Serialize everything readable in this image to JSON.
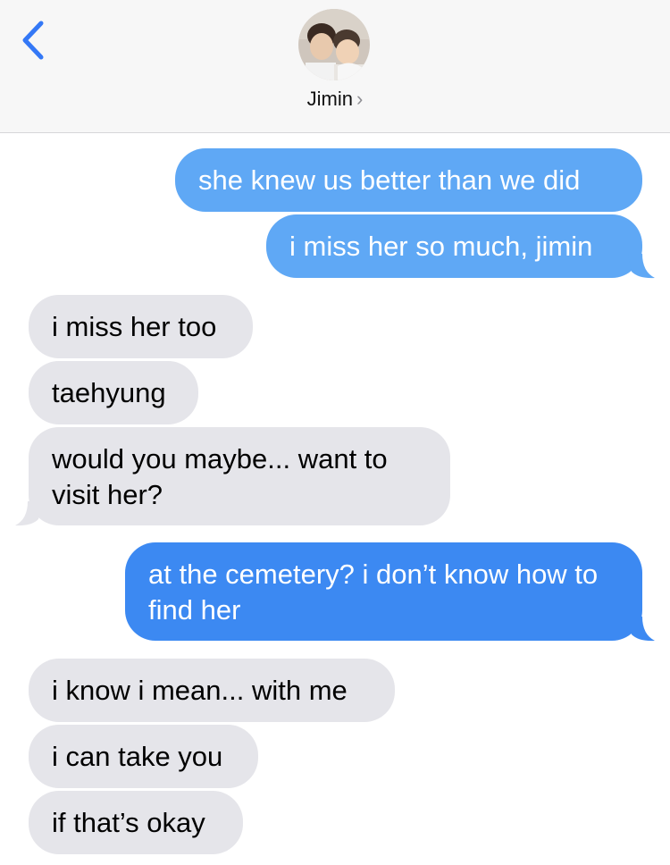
{
  "header": {
    "contact_name": "Jimin",
    "chevron": "›",
    "back_icon": "chevron-left-icon"
  },
  "messages": [
    {
      "side": "sent",
      "text": "she knew us better than we did"
    },
    {
      "side": "sent",
      "text": "i miss her so much, jimin"
    },
    {
      "side": "received",
      "text": "i miss her too"
    },
    {
      "side": "received",
      "text": "taehyung"
    },
    {
      "side": "received",
      "text": "would you maybe... want to visit her?"
    },
    {
      "side": "sent",
      "text": "at the cemetery? i don’t know how to find her"
    },
    {
      "side": "received",
      "text": "i know i mean... with me"
    },
    {
      "side": "received",
      "text": "i can take you"
    },
    {
      "side": "received",
      "text": "if that’s okay"
    }
  ],
  "colors": {
    "sent_bubble": "#5fa8f5",
    "sent_bubble_bottom": "#3c89f2",
    "received_bubble": "#e5e5ea",
    "accent_blue": "#3478f6"
  }
}
